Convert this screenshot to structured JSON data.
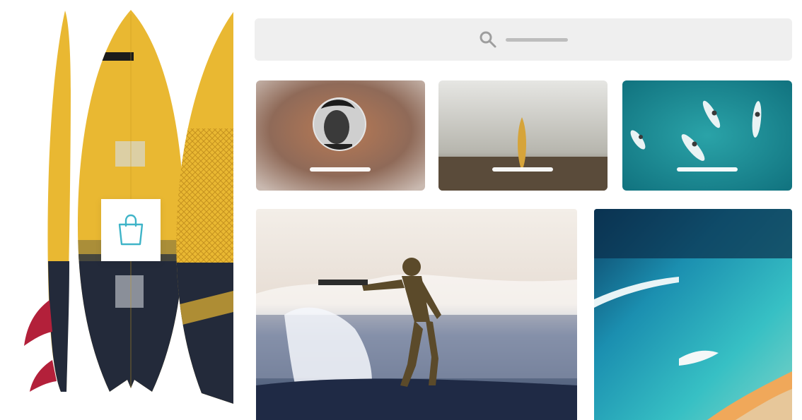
{
  "product": {
    "icons": {
      "bag": "shopping-bag-icon"
    },
    "colors": {
      "board_yellow": "#e9b832",
      "board_navy": "#232a3a",
      "fin_red": "#b3203a",
      "bag_teal": "#3fb4c8"
    }
  },
  "search": {
    "icon": "search-icon",
    "placeholder": ""
  },
  "gallery": {
    "tiles": [
      {
        "id": "profile",
        "image": "portrait-avatar",
        "caption": ""
      },
      {
        "id": "beach-board",
        "image": "surfboard-on-beach",
        "caption": ""
      },
      {
        "id": "aerial-surfers",
        "image": "aerial-surfers",
        "caption": ""
      },
      {
        "id": "surfer-wave",
        "image": "surfer-on-wave"
      },
      {
        "id": "ocean-aerial",
        "image": "aerial-ocean"
      }
    ]
  },
  "colors": {
    "search_bg": "#efefef",
    "search_icon": "#9e9e9e",
    "caption_bar": "#ffffff"
  }
}
